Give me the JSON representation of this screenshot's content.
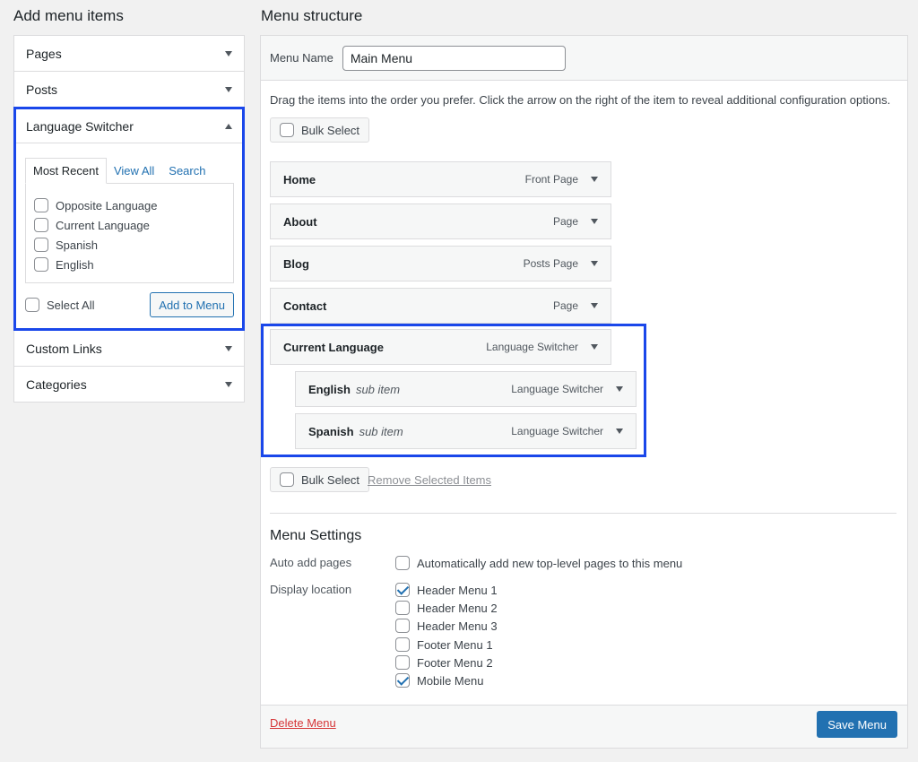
{
  "left": {
    "title": "Add menu items",
    "sections": {
      "pages": "Pages",
      "posts": "Posts",
      "language_switcher": "Language Switcher",
      "custom_links": "Custom Links",
      "categories": "Categories"
    },
    "tabs": {
      "most_recent": "Most Recent",
      "view_all": "View All",
      "search": "Search"
    },
    "options": [
      "Opposite Language",
      "Current Language",
      "Spanish",
      "English"
    ],
    "select_all": "Select All",
    "add_to_menu": "Add to Menu"
  },
  "right": {
    "title": "Menu structure",
    "menu_name_label": "Menu Name",
    "menu_name_value": "Main Menu",
    "instructions": "Drag the items into the order you prefer. Click the arrow on the right of the item to reveal additional configuration options.",
    "bulk_select": "Bulk Select",
    "remove_selected": "Remove Selected Items",
    "items": [
      {
        "title": "Home",
        "sub": "",
        "type": "Front Page"
      },
      {
        "title": "About",
        "sub": "",
        "type": "Page"
      },
      {
        "title": "Blog",
        "sub": "",
        "type": "Posts Page"
      },
      {
        "title": "Contact",
        "sub": "",
        "type": "Page"
      },
      {
        "title": "Current Language",
        "sub": "",
        "type": "Language Switcher"
      },
      {
        "title": "English",
        "sub": "sub item",
        "type": "Language Switcher"
      },
      {
        "title": "Spanish",
        "sub": "sub item",
        "type": "Language Switcher"
      }
    ],
    "settings": {
      "title": "Menu Settings",
      "auto_add_label": "Auto add pages",
      "auto_add_option": "Automatically add new top-level pages to this menu",
      "display_location_label": "Display location",
      "locations": [
        {
          "label": "Header Menu 1",
          "checked": true
        },
        {
          "label": "Header Menu 2",
          "checked": false
        },
        {
          "label": "Header Menu 3",
          "checked": false
        },
        {
          "label": "Footer Menu 1",
          "checked": false
        },
        {
          "label": "Footer Menu 2",
          "checked": false
        },
        {
          "label": "Mobile Menu",
          "checked": true
        }
      ]
    },
    "delete_menu": "Delete Menu",
    "save_menu": "Save Menu"
  },
  "colors": {
    "highlight": "#1a47ea",
    "primary": "#2271b1",
    "danger": "#d63638"
  }
}
